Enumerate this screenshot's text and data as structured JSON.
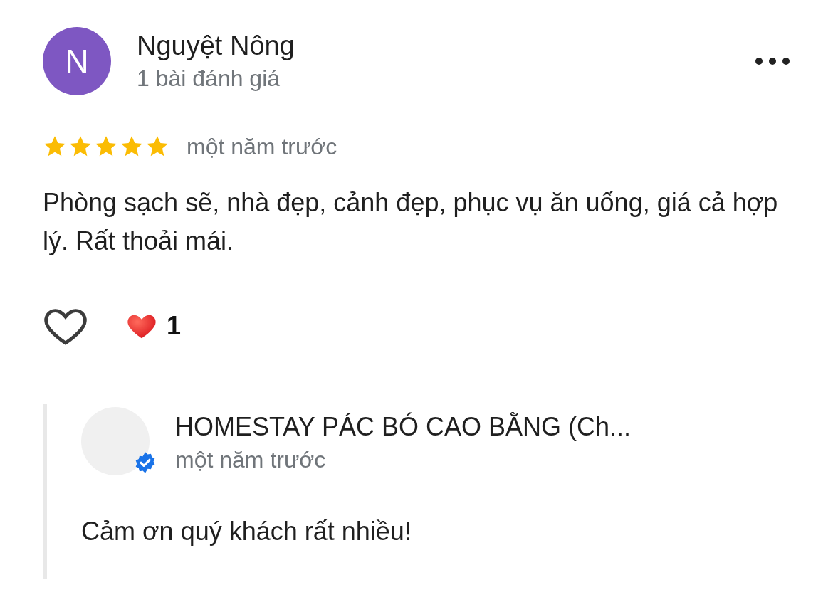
{
  "review": {
    "author": {
      "initial": "N",
      "name": "Nguyệt Nông",
      "review_count": "1 bài đánh giá"
    },
    "stars": 5,
    "time": "một năm trước",
    "text": "Phòng sạch sẽ, nhà đẹp, cảnh đẹp, phục vụ ăn uống, giá cả hợp lý. Rất thoải mái.",
    "reactions": {
      "liked": false,
      "count": "1"
    }
  },
  "reply": {
    "owner": {
      "name": "HOMESTAY PÁC BÓ CAO BẰNG (Ch...",
      "verified": true,
      "time": "một năm trước"
    },
    "text": "Cảm ơn quý khách rất nhiều!"
  }
}
